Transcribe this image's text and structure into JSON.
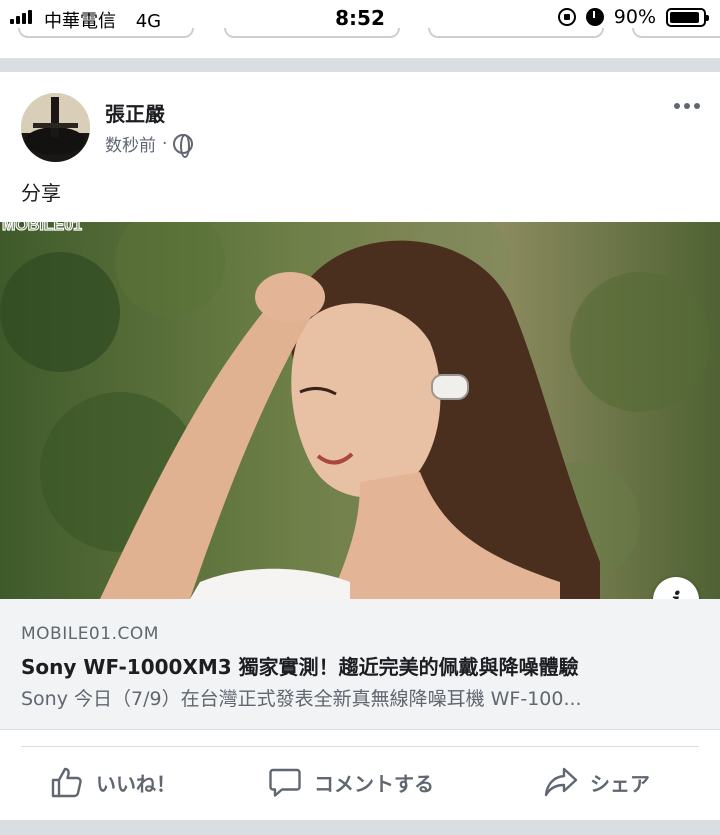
{
  "status_bar": {
    "carrier": "中華電信",
    "network": "4G",
    "time": "8:52",
    "battery_percent": "90%",
    "battery_level": 0.9
  },
  "post": {
    "author": "張正嚴",
    "timestamp": "数秒前",
    "separator": "·",
    "text": "分享",
    "watermark": "MOBILE01"
  },
  "link_preview": {
    "domain": "MOBILE01.COM",
    "title": "Sony WF-1000XM3 獨家實測！趨近完美的佩戴與降噪體驗",
    "description": "Sony 今日（7/9）在台灣正式發表全新真無線降噪耳機 WF-100..."
  },
  "actions": {
    "like_label": "いいね！",
    "comment_label": "コメントする",
    "share_label": "シェア"
  },
  "colors": {
    "secondary_text": "#606770",
    "separator": "#dadde1",
    "link_bg": "#f2f3f5"
  },
  "icons": [
    "signal-icon",
    "rotation-lock-icon",
    "alarm-icon",
    "battery-icon",
    "globe-icon",
    "more-icon",
    "info-icon",
    "like-icon",
    "comment-icon",
    "share-icon"
  ]
}
